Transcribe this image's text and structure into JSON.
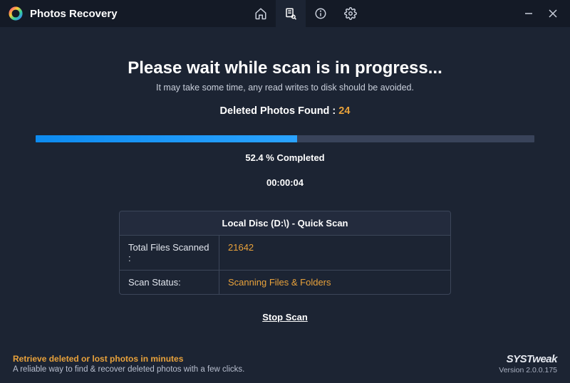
{
  "app": {
    "title": "Photos Recovery"
  },
  "scan": {
    "headline": "Please wait while scan is in progress...",
    "subline": "It may take some time, any read writes to disk should be avoided.",
    "found_label": "Deleted Photos Found :",
    "found_count": "24",
    "percent": 52.4,
    "percent_text": "52.4 % Completed",
    "elapsed": "00:00:04",
    "panel_title": "Local Disc (D:\\) - Quick Scan",
    "rows": [
      {
        "label": "Total Files Scanned :",
        "value": "21642"
      },
      {
        "label": "Scan Status:",
        "value": "Scanning Files & Folders"
      }
    ],
    "stop_label": "Stop Scan"
  },
  "footer": {
    "line1": "Retrieve deleted or lost photos in minutes",
    "line2": "A reliable way to find & recover deleted photos with a few clicks.",
    "brand": "SYSTweak",
    "version": "Version 2.0.0.175"
  },
  "colors": {
    "accent": "#e9a23b",
    "progress": "#2196f3"
  }
}
